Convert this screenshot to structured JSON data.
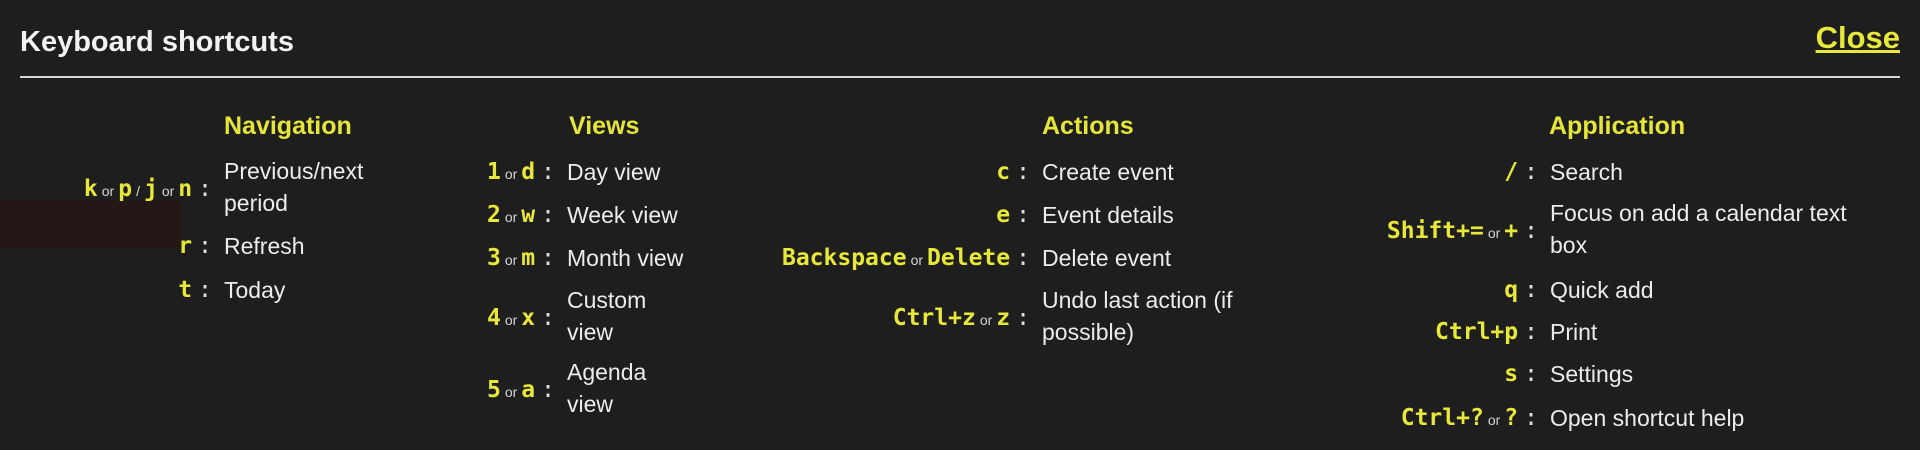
{
  "dialog": {
    "title": "Keyboard shortcuts",
    "close_label": "Close"
  },
  "sections": {
    "navigation": {
      "title": "Navigation",
      "items": [
        {
          "keys": [
            "k",
            "p",
            "j",
            "n"
          ],
          "seps": [
            "or",
            "/",
            "or"
          ],
          "desc": "Previous/next period"
        },
        {
          "keys": [
            "r"
          ],
          "seps": [],
          "desc": "Refresh"
        },
        {
          "keys": [
            "t"
          ],
          "seps": [],
          "desc": "Today"
        }
      ]
    },
    "views": {
      "title": "Views",
      "items": [
        {
          "keys": [
            "1",
            "d"
          ],
          "seps": [
            "or"
          ],
          "desc": "Day view"
        },
        {
          "keys": [
            "2",
            "w"
          ],
          "seps": [
            "or"
          ],
          "desc": "Week view"
        },
        {
          "keys": [
            "3",
            "m"
          ],
          "seps": [
            "or"
          ],
          "desc": "Month view"
        },
        {
          "keys": [
            "4",
            "x"
          ],
          "seps": [
            "or"
          ],
          "desc": "Custom view"
        },
        {
          "keys": [
            "5",
            "a"
          ],
          "seps": [
            "or"
          ],
          "desc": "Agenda view"
        }
      ]
    },
    "actions": {
      "title": "Actions",
      "items": [
        {
          "keys": [
            "c"
          ],
          "seps": [],
          "desc": "Create event"
        },
        {
          "keys": [
            "e"
          ],
          "seps": [],
          "desc": "Event details"
        },
        {
          "keys": [
            "Backspace",
            "Delete"
          ],
          "seps": [
            "or"
          ],
          "desc": "Delete event"
        },
        {
          "keys": [
            "Ctrl+z",
            "z"
          ],
          "seps": [
            "or"
          ],
          "desc": "Undo last action (if possible)"
        }
      ]
    },
    "application": {
      "title": "Application",
      "items": [
        {
          "keys": [
            "/"
          ],
          "seps": [],
          "desc": "Search"
        },
        {
          "keys": [
            "Shift+=",
            "+"
          ],
          "seps": [
            "or"
          ],
          "desc": "Focus on add a calendar text box"
        },
        {
          "keys": [
            "q"
          ],
          "seps": [],
          "desc": "Quick add"
        },
        {
          "keys": [
            "Ctrl+p"
          ],
          "seps": [],
          "desc": "Print"
        },
        {
          "keys": [
            "s"
          ],
          "seps": [],
          "desc": "Settings"
        },
        {
          "keys": [
            "Ctrl+?",
            "?"
          ],
          "seps": [
            "or"
          ],
          "desc": "Open shortcut help"
        }
      ]
    }
  },
  "colors": {
    "accent": "#e8e83a",
    "background": "#2b2b2b",
    "text": "#ececec"
  }
}
